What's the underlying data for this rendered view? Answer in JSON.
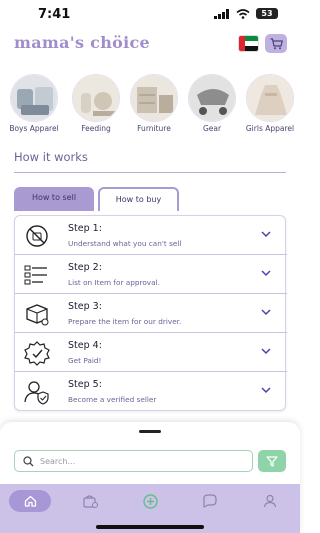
{
  "status_bar": {
    "time": "7:41",
    "battery": "53"
  },
  "header": {
    "logo": "mama's chöice",
    "flag": "uae-flag-icon",
    "cart": "cart-icon"
  },
  "categories": [
    {
      "label": "Boys Apparel"
    },
    {
      "label": "Feeding"
    },
    {
      "label": "Furniture"
    },
    {
      "label": "Gear"
    },
    {
      "label": "Girls Apparel"
    }
  ],
  "how_it_works": {
    "title": "How it works",
    "tabs": [
      {
        "label": "How to sell",
        "active": true
      },
      {
        "label": "How to buy",
        "active": false
      }
    ],
    "steps": [
      {
        "title": "Step 1:",
        "desc": "Understand what you can't sell",
        "icon": "prohibited-icon"
      },
      {
        "title": "Step 2:",
        "desc": "List on Item for approval.",
        "icon": "checklist-icon"
      },
      {
        "title": "Step 3:",
        "desc": "Prepare the item for our driver.",
        "icon": "package-tag-icon"
      },
      {
        "title": "Step 4:",
        "desc": "Get Paid!",
        "icon": "payment-badge-icon"
      },
      {
        "title": "Step 5:",
        "desc": "Become a verified seller",
        "icon": "verified-user-icon"
      }
    ]
  },
  "search": {
    "placeholder": "Search..."
  },
  "nav": [
    "home-icon",
    "sell-bag-icon",
    "add-icon",
    "messages-icon",
    "profile-icon"
  ],
  "colors": {
    "accent": "#a99ad2",
    "nav_bg": "#ccc2e8",
    "green": "#8fd4a9",
    "text": "#4a4370"
  }
}
